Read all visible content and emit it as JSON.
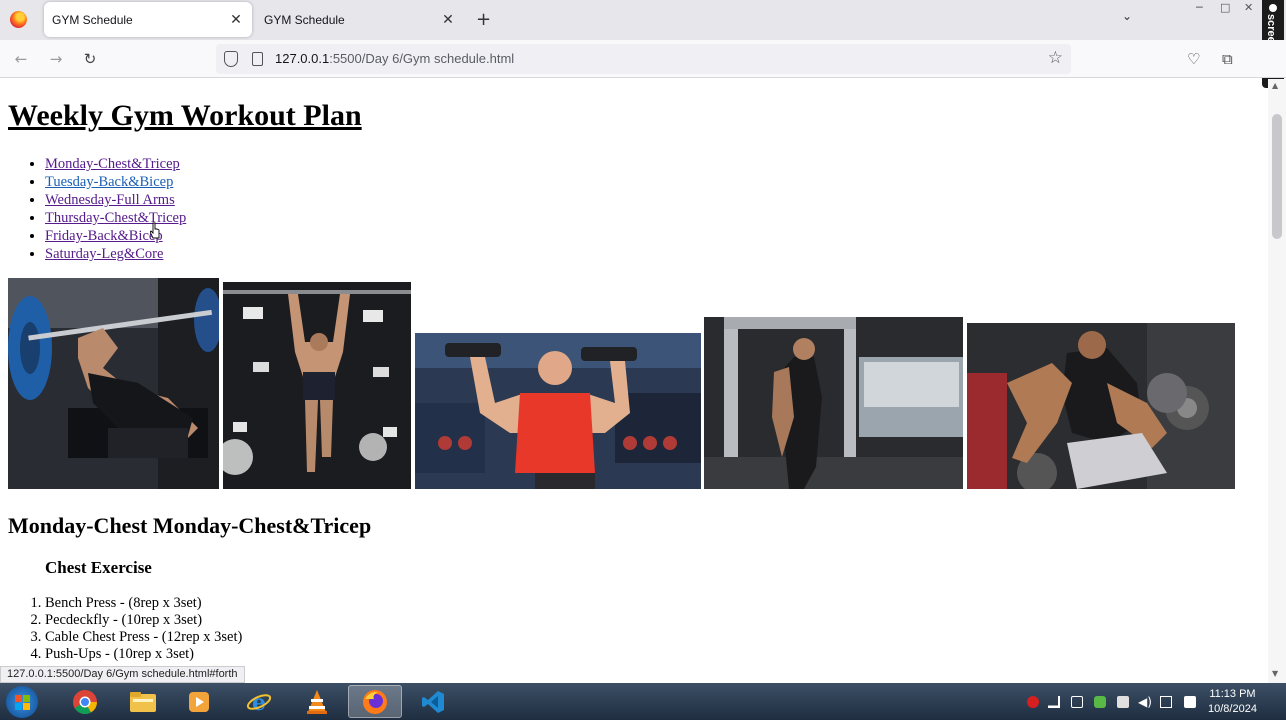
{
  "browser": {
    "tabs": [
      {
        "title": "GYM Schedule",
        "active": true
      },
      {
        "title": "GYM Schedule",
        "active": false
      }
    ],
    "new_tab_glyph": "+",
    "url_host": "127.0.0.1",
    "url_path": ":5500/Day 6/Gym schedule.html",
    "recorder_label": "screentec"
  },
  "page": {
    "title": "Weekly Gym Workout Plan",
    "days": [
      "Monday-Chest&Tricep",
      "Tuesday-Back&Bicep",
      "Wednesday-Full Arms",
      "Thursday-Chest&Tricep",
      "Friday-Back&Bicep",
      "Saturday-Leg&Core"
    ],
    "section_heading": "Monday-Chest Monday-Chest&Tricep",
    "subheading": "Chest Exercise",
    "exercises": [
      "Bench Press - (8rep x 3set)",
      "Pecdeckfly - (10rep x 3set)",
      "Cable Chest Press - (12rep x 3set)",
      "Push-Ups - (10rep x 3set)"
    ]
  },
  "status_bar": "127.0.0.1:5500/Day 6/Gym schedule.html#forth",
  "taskbar": {
    "time": "11:13 PM",
    "date": "10/8/2024"
  },
  "colors": {
    "link": "#551a8b",
    "link_alt": "#1a5fb4",
    "taskbar": "#2a3b50"
  }
}
